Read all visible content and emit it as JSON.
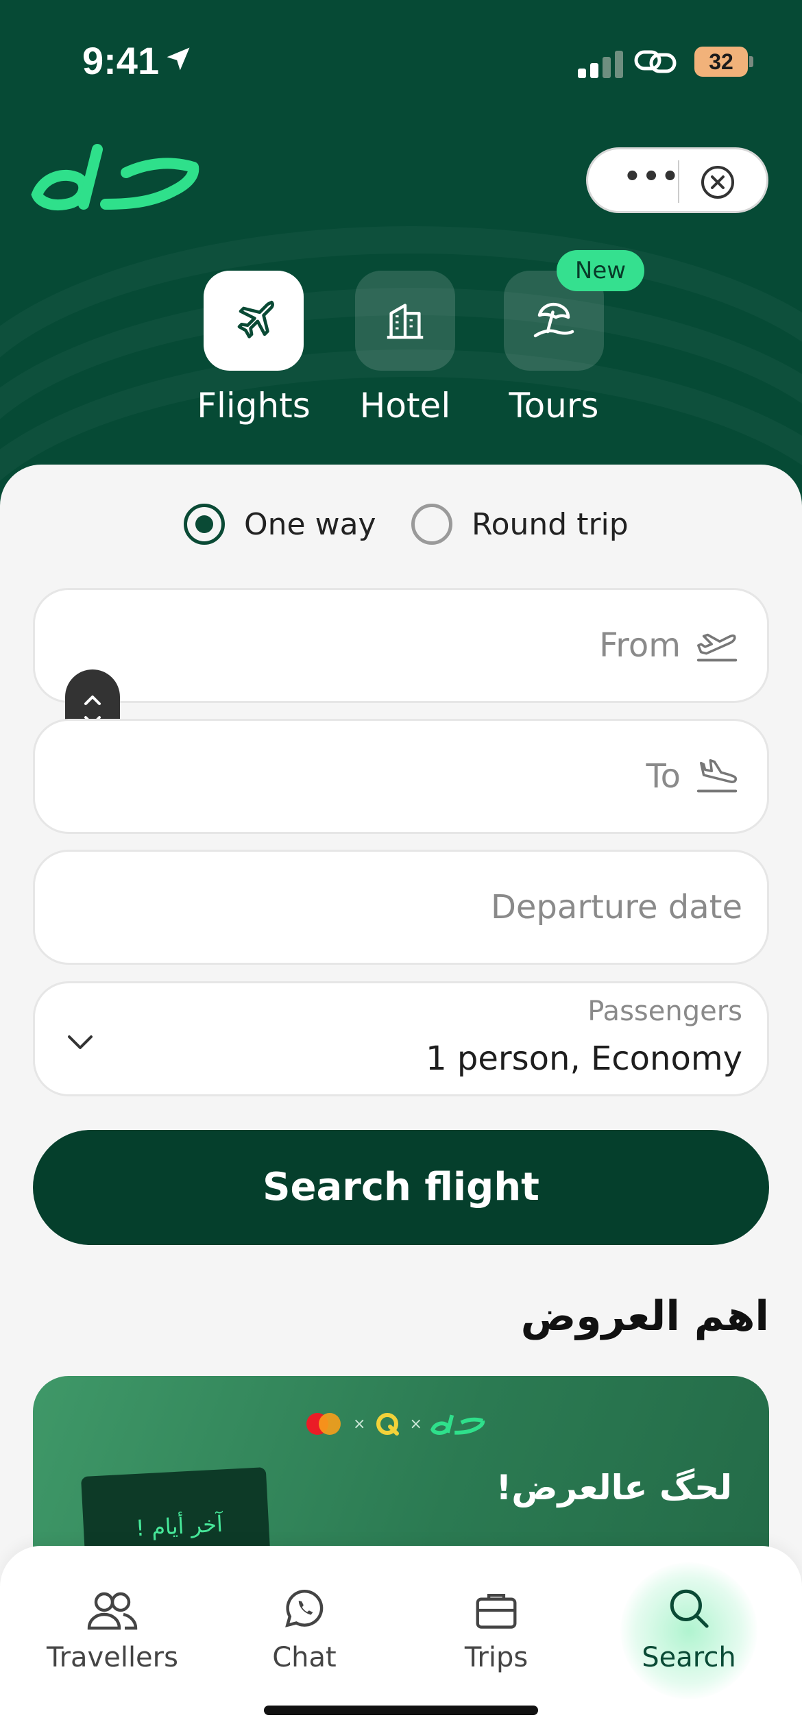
{
  "status_bar": {
    "time": "9:41",
    "battery": "32"
  },
  "colors": {
    "header": "#064a35",
    "accent": "#35e08f",
    "primary_button": "#053f2c"
  },
  "categories": [
    {
      "label": "Flights",
      "icon": "plane-icon",
      "active": true
    },
    {
      "label": "Hotel",
      "icon": "building-icon",
      "active": false
    },
    {
      "label": "Tours",
      "icon": "beach-umbrella-icon",
      "active": false,
      "badge": "New"
    }
  ],
  "trip_type": {
    "one_way": "One way",
    "round_trip": "Round trip",
    "selected": "One way"
  },
  "fields": {
    "from_placeholder": "From",
    "to_placeholder": "To",
    "departure_placeholder": "Departure date",
    "passengers_label": "Passengers",
    "passengers_value": "1 person, Economy"
  },
  "search_button": "Search flight",
  "offers": {
    "title": "اهم العروض",
    "promo_headline": "لحگ عالعرض!",
    "promo_calendar_text": "آخر أيام !"
  },
  "tabs": [
    {
      "label": "Travellers",
      "icon": "people-icon"
    },
    {
      "label": "Chat",
      "icon": "whatsapp-icon"
    },
    {
      "label": "Trips",
      "icon": "briefcase-icon"
    },
    {
      "label": "Search",
      "icon": "search-icon",
      "active": true
    }
  ]
}
